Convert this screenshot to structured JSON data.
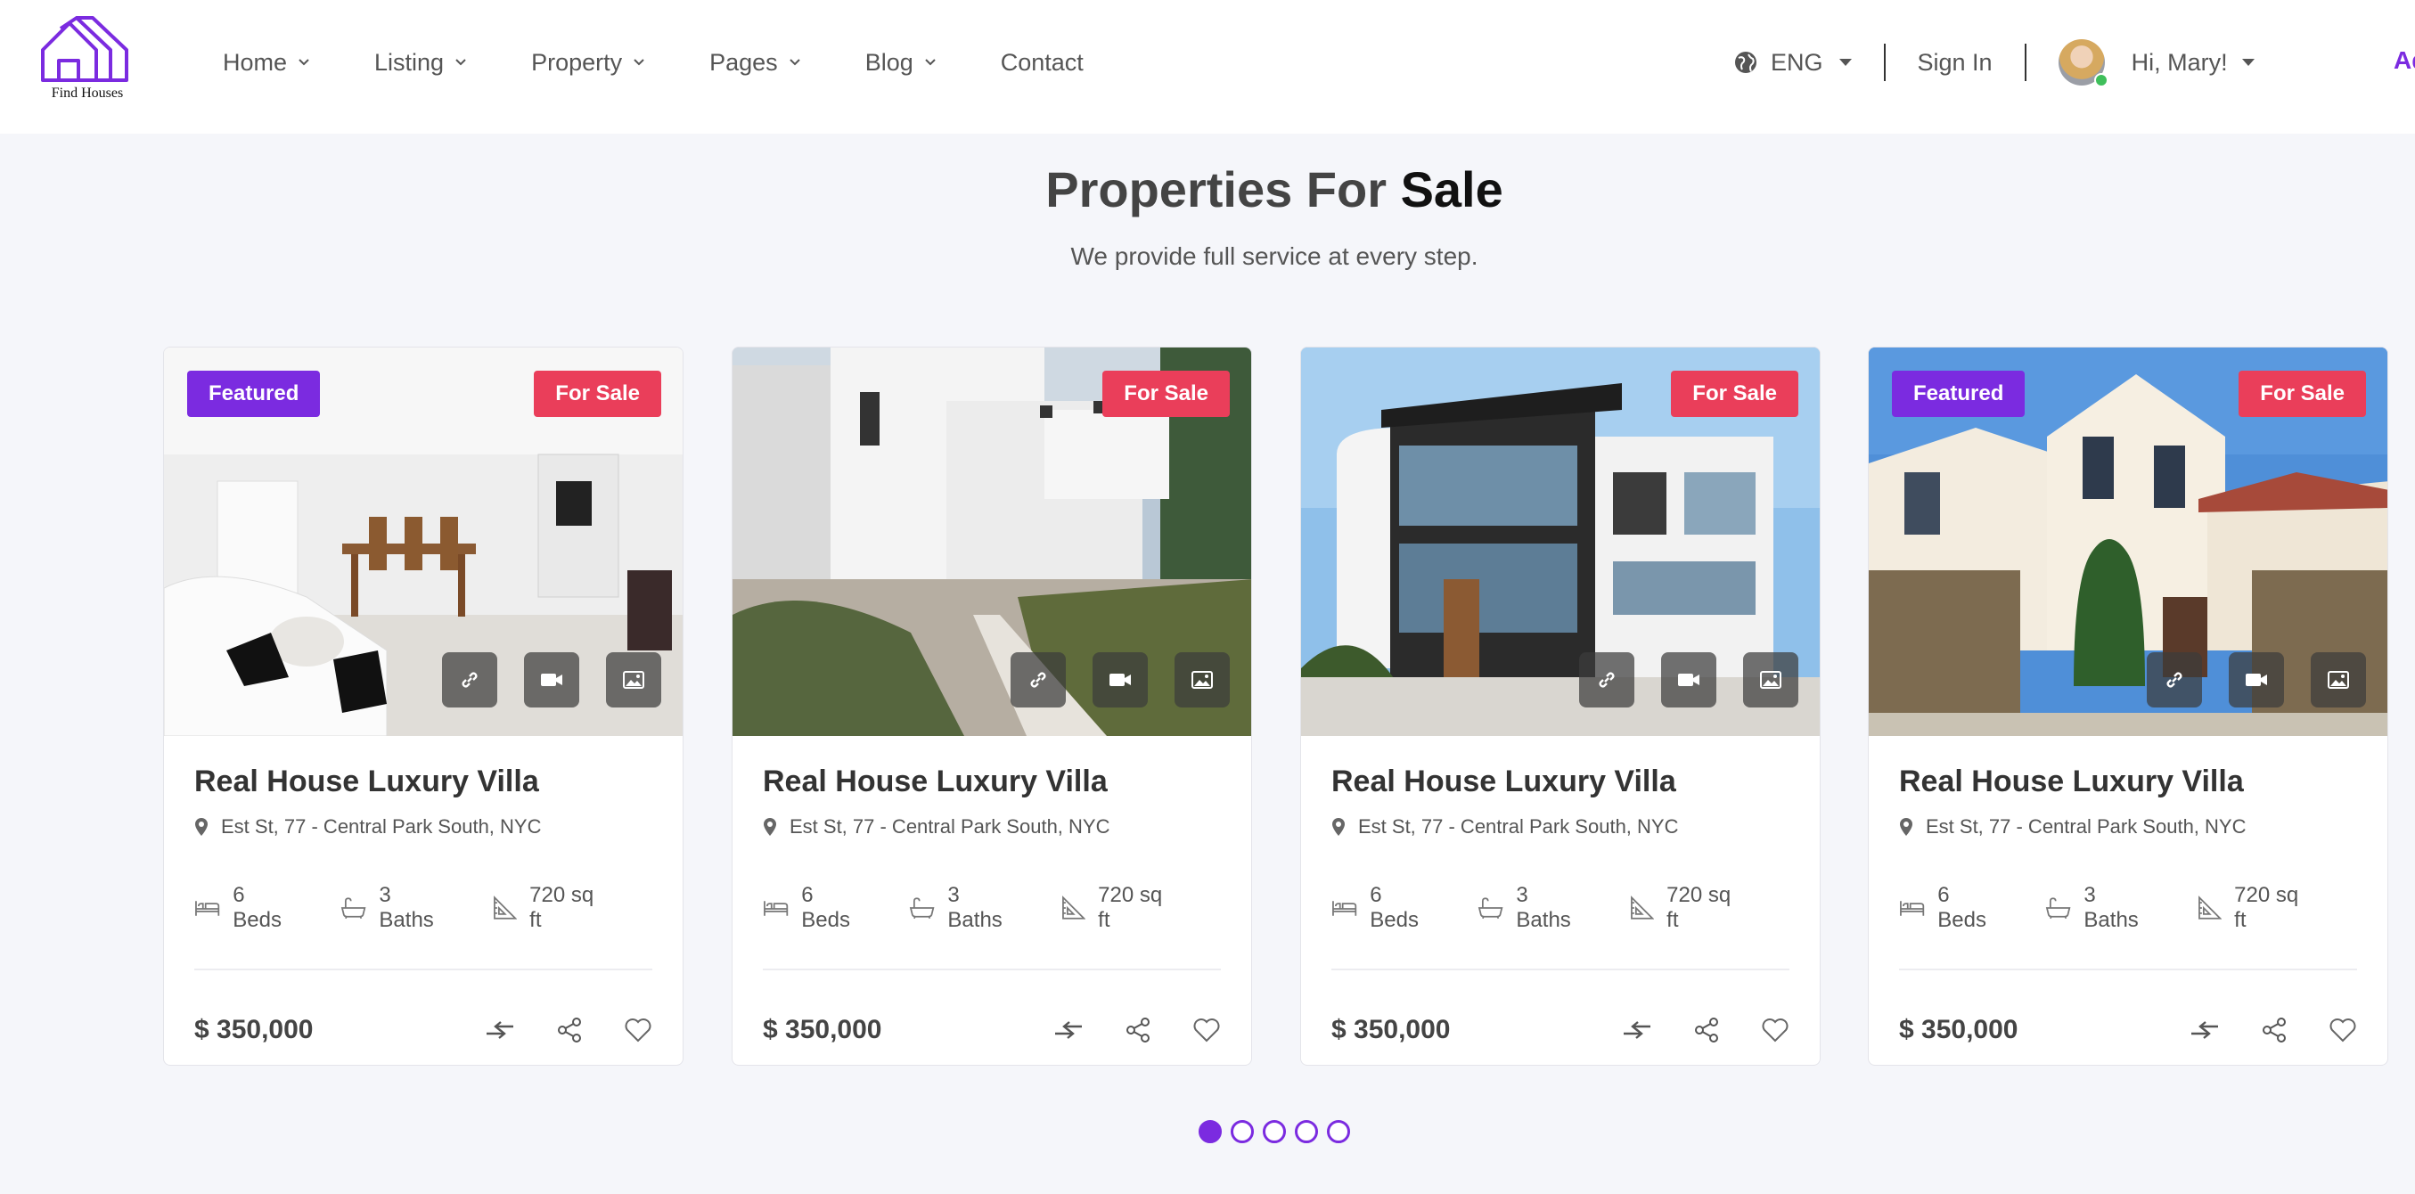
{
  "brand": {
    "logo_text": "Find Houses",
    "accent": "#7b2be0",
    "sale_color": "#ea3e5a"
  },
  "nav": {
    "items": [
      {
        "label": "Home",
        "has_dropdown": true
      },
      {
        "label": "Listing",
        "has_dropdown": true
      },
      {
        "label": "Property",
        "has_dropdown": true
      },
      {
        "label": "Pages",
        "has_dropdown": true
      },
      {
        "label": "Blog",
        "has_dropdown": true
      },
      {
        "label": "Contact",
        "has_dropdown": false
      }
    ]
  },
  "header_right": {
    "language": "ENG",
    "sign_in": "Sign In",
    "greeting": "Hi, Mary!",
    "add_listing": "Ad"
  },
  "section": {
    "title_part1": "Properties For",
    "title_part2": "Sale",
    "subtitle": "We provide full service at every step."
  },
  "properties": [
    {
      "featured_badge": "Featured",
      "status_badge": "For Sale",
      "title": "Real House Luxury Villa",
      "address": "Est St, 77 - Central Park South, NYC",
      "beds": "6 Beds",
      "baths": "3 Baths",
      "area": "720 sq ft",
      "price": "$ 350,000",
      "image": "interior-living-dining"
    },
    {
      "featured_badge": "",
      "status_badge": "For Sale",
      "title": "Real House Luxury Villa",
      "address": "Est St, 77 - Central Park South, NYC",
      "beds": "6 Beds",
      "baths": "3 Baths",
      "area": "720 sq ft",
      "price": "$ 350,000",
      "image": "white-modern-house"
    },
    {
      "featured_badge": "",
      "status_badge": "For Sale",
      "title": "Real House Luxury Villa",
      "address": "Est St, 77 - Central Park South, NYC",
      "beds": "6 Beds",
      "baths": "3 Baths",
      "area": "720 sq ft",
      "price": "$ 350,000",
      "image": "modern-glass-house"
    },
    {
      "featured_badge": "Featured",
      "status_badge": "For Sale",
      "title": "Real House Luxury Villa",
      "address": "Est St, 77 - Central Park South, NYC",
      "beds": "6 Beds",
      "baths": "3 Baths",
      "area": "720 sq ft",
      "price": "$ 350,000",
      "image": "mediterranean-villa"
    }
  ],
  "pagination": {
    "count": 5,
    "active": 1
  }
}
